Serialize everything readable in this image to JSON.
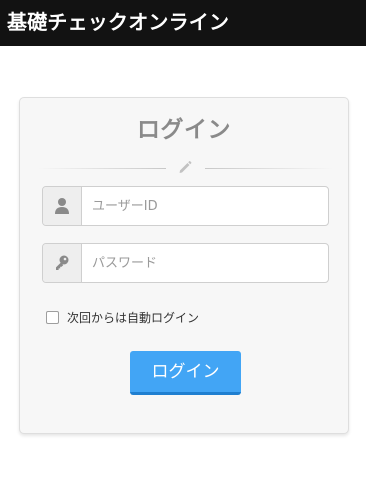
{
  "header": {
    "title": "基礎チェックオンライン",
    "background": "#121212"
  },
  "login_card": {
    "title": "ログイン",
    "divider_icon": "pencil-icon",
    "userid": {
      "icon": "user-icon",
      "placeholder": "ユーザーID",
      "value": ""
    },
    "password": {
      "icon": "key-icon",
      "placeholder": "パスワード",
      "value": ""
    },
    "remember": {
      "label": "次回からは自動ログイン",
      "checked": false
    },
    "submit_label": "ログイン",
    "accent_color": "#42a5f5"
  }
}
